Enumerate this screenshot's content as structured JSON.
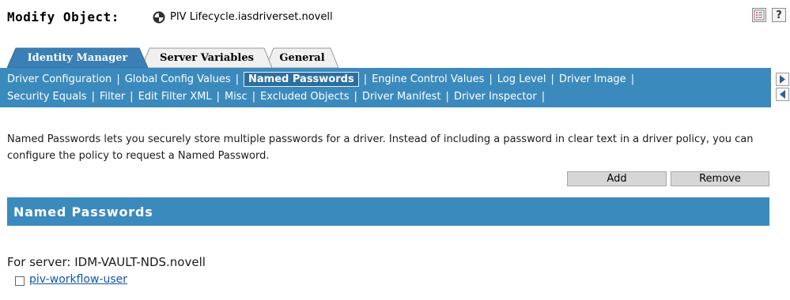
{
  "header": {
    "title_label": "Modify Object:",
    "object_name": "PIV Lifecycle.iasdriverset.novell",
    "help_label": "?",
    "object_icon": "driver-set-icon",
    "tasks_icon": "task-list-icon"
  },
  "tabs": [
    {
      "label": "Identity Manager",
      "active": true
    },
    {
      "label": "Server Variables",
      "active": false
    },
    {
      "label": "General",
      "active": false
    }
  ],
  "submenu": {
    "row1": [
      "Driver Configuration",
      "Global Config Values",
      "Named Passwords",
      "Engine Control Values",
      "Log Level",
      "Driver Image"
    ],
    "row2": [
      "Security Equals",
      "Filter",
      "Edit Filter XML",
      "Misc",
      "Excluded Objects",
      "Driver Manifest",
      "Driver Inspector"
    ],
    "active": "Named Passwords",
    "separator": "|"
  },
  "description": "Named Passwords lets you securely store multiple passwords for a driver. Instead of including a password in clear text in a driver policy, you can configure the policy to request a Named Password.",
  "actions": {
    "add_label": "Add",
    "remove_label": "Remove"
  },
  "section": {
    "title": "Named Passwords"
  },
  "server": {
    "line": "For server: IDM-VAULT-NDS.novell"
  },
  "passwords": [
    {
      "name": "piv-workflow-user",
      "checked": false
    }
  ],
  "colors": {
    "accent_blue": "#3b8abd",
    "tab_active": "#3a7fb5",
    "tab_inactive": "#f0f0f0",
    "link": "#1155aa"
  }
}
